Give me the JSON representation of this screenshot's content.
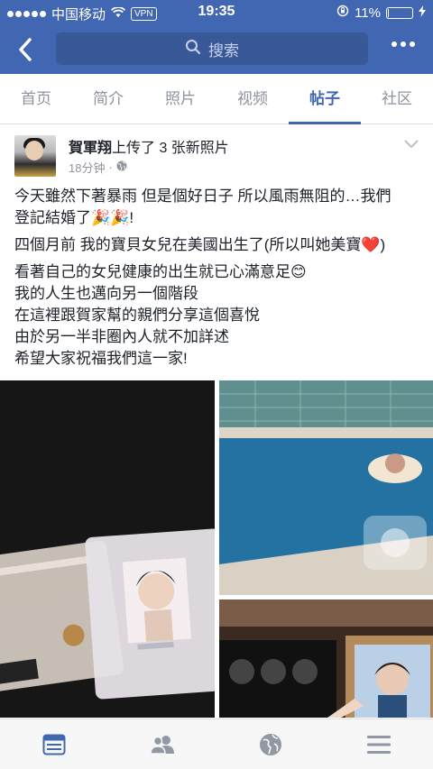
{
  "status_bar": {
    "carrier": "中国移动",
    "vpn": "VPN",
    "time": "19:35",
    "battery": "11%",
    "battery_level": 0.11
  },
  "nav": {
    "search_placeholder": "搜索"
  },
  "tabs": [
    {
      "label": "首页",
      "active": false
    },
    {
      "label": "简介",
      "active": false
    },
    {
      "label": "照片",
      "active": false
    },
    {
      "label": "视频",
      "active": false
    },
    {
      "label": "帖子",
      "active": true
    },
    {
      "label": "社区",
      "active": false
    }
  ],
  "post": {
    "author": "賀軍翔",
    "action": "上传了 3 张新照片",
    "time": "18分钟",
    "text_lines": [
      "今天雖然下著暴雨 但是個好日子 所以風雨無阻的…我們",
      "登記結婚了🎉🎉!",
      "四個月前 我的寶貝女兒在美國出生了(所以叫她美寶❤️)",
      "看著自己的女兒健康的出生就已心滿意足😊",
      "我的人生也邁向另一個階段",
      "在這裡跟賀家幫的親們分享這個喜悅",
      "由於另一半非圈內人就不加詳述",
      "希望大家祝福我們這一家!"
    ]
  },
  "colors": {
    "brand": "#4267b2",
    "tab_inactive": "#8d949e",
    "meta": "#90949c"
  }
}
